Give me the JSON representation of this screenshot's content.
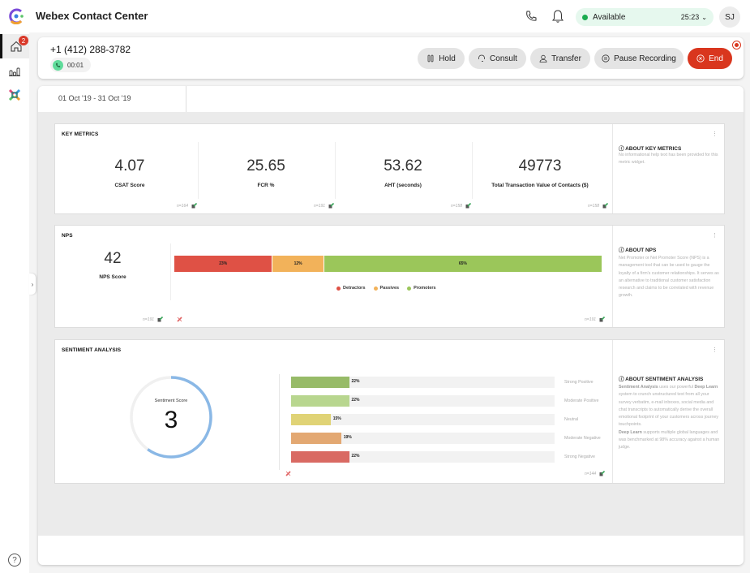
{
  "app": {
    "title": "Webex Contact Center",
    "status": "Available",
    "status_timer": "25:23",
    "avatar_initials": "SJ",
    "status_color": "#1aab4f"
  },
  "sidebar": {
    "items": [
      {
        "name": "home",
        "badge": "2",
        "active": true
      },
      {
        "name": "analytics",
        "active": false
      },
      {
        "name": "apps",
        "active": false
      }
    ],
    "help_label": "?"
  },
  "call": {
    "number": "+1 (412) 288-3782",
    "duration": "00:01",
    "buttons": {
      "hold": "Hold",
      "consult": "Consult",
      "transfer": "Transfer",
      "pause_recording": "Pause Recording",
      "end": "End"
    },
    "end_color": "#d9361e"
  },
  "dashboard": {
    "date_range": "01 Oct '19 - 31 Oct '19",
    "key_metrics": {
      "title": "KEY METRICS",
      "metrics": [
        {
          "value": "4.07",
          "label": "CSAT Score",
          "n": "n=164"
        },
        {
          "value": "25.65",
          "label": "FCR %",
          "n": "n=191"
        },
        {
          "value": "53.62",
          "label": "AHT (seconds)",
          "n": "n=158"
        },
        {
          "value": "49773",
          "label": "Total Transaction Value of Contacts ($)",
          "n": "n=158"
        }
      ],
      "about_title": "ABOUT KEY METRICS",
      "about_text": "No informational help text has been provided for this metric widget."
    },
    "nps": {
      "title": "NPS",
      "score": "42",
      "score_label": "NPS Score",
      "n_left": "n=191",
      "n_right": "n=191",
      "about_title": "ABOUT NPS",
      "about_text": "Net Promoter or Net Promoter Score (NPS) is a management tool that can be used to gauge the loyalty of a firm's customer relationships. It serves as an alternative to traditional customer satisfaction research and claims to be correlated with revenue growth."
    },
    "sentiment": {
      "title": "SENTIMENT ANALYSIS",
      "score_label": "Sentiment Score",
      "score": "3",
      "score_max": 5,
      "n": "n=144",
      "about_title": "ABOUT SENTIMENT ANALYSIS",
      "about_parts": {
        "b1": "Sentiment Analysis",
        "t1": " uses our powerful ",
        "b2": "Deep Learn",
        "t2": " system to crunch unstructured text from all your survey verbatim, e-mail inboxes, social media and chat transcripts to automatically derive the overall emotional footprint of your customers across journey touchpoints.",
        "b3": "Deep Learn",
        "t3": " supports multiple global languages and was benchmarked at 98% accuracy against a human judge."
      }
    }
  },
  "chart_data": [
    {
      "type": "bar",
      "title": "NPS",
      "orientation": "horizontal-stacked",
      "categories": [
        "Detractors",
        "Passives",
        "Promoters"
      ],
      "values": [
        23,
        12,
        65
      ],
      "labels": [
        "23%",
        "12%",
        "65%"
      ],
      "colors": [
        "#df5145",
        "#f2b25a",
        "#9bc65a"
      ],
      "legend": "bottom-center",
      "unit": "%"
    },
    {
      "type": "bar",
      "title": "Sentiment Analysis",
      "orientation": "horizontal",
      "categories": [
        "Strong Positive",
        "Moderate Positive",
        "Neutral",
        "Moderate Negative",
        "Strong Negative"
      ],
      "values": [
        22,
        22,
        15,
        19,
        22
      ],
      "labels": [
        "22%",
        "22%",
        "15%",
        "19%",
        "22%"
      ],
      "colors": [
        "#97bb68",
        "#b8d68f",
        "#e0d376",
        "#e3a872",
        "#d96a63"
      ],
      "xlim": [
        0,
        100
      ],
      "unit": "%"
    },
    {
      "type": "pie",
      "title": "Sentiment Score",
      "subtype": "gauge",
      "value": 3,
      "max": 5,
      "color": "#8ab8e6",
      "track_color": "#f0f0f0"
    }
  ]
}
